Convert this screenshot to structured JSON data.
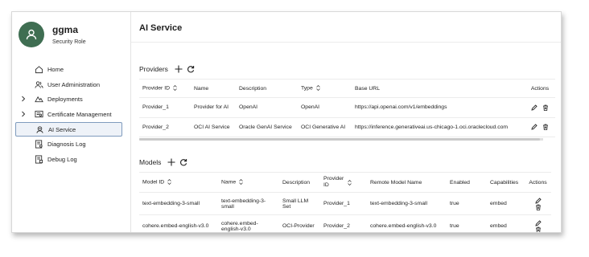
{
  "user": {
    "name": "ggma",
    "role": "Security Role"
  },
  "nav": [
    {
      "label": "Home",
      "icon": "home-icon",
      "chevron": false,
      "active": false
    },
    {
      "label": "User Administration",
      "icon": "users-icon",
      "chevron": false,
      "active": false
    },
    {
      "label": "Deployments",
      "icon": "deployments-icon",
      "chevron": true,
      "active": false
    },
    {
      "label": "Certificate Management",
      "icon": "certificate-icon",
      "chevron": true,
      "active": false
    },
    {
      "label": "AI Service",
      "icon": "ai-service-icon",
      "chevron": false,
      "active": true
    },
    {
      "label": "Diagnosis Log",
      "icon": "diagnosis-log-icon",
      "chevron": false,
      "active": false
    },
    {
      "label": "Debug Log",
      "icon": "debug-log-icon",
      "chevron": false,
      "active": false
    }
  ],
  "page": {
    "title": "AI Service"
  },
  "providers": {
    "label": "Providers",
    "columns": [
      "Provider ID",
      "Name",
      "Description",
      "Type",
      "Base URL",
      "Actions"
    ],
    "rows": [
      [
        "Provider_1",
        "Provider for AI",
        "OpenAI",
        "OpenAI",
        "https://api.openai.com/v1/embeddings"
      ],
      [
        "Provider_2",
        "OCI AI Service",
        "Oracle GenAI Service",
        "OCI Generative AI",
        "https://inference.generativeai.us-chicago-1.oci.oraclecloud.com"
      ]
    ]
  },
  "models": {
    "label": "Models",
    "columns": [
      "Model ID",
      "Name",
      "Description",
      "Provider ID",
      "Remote Model Name",
      "Enabled",
      "Capabilities",
      "Actions"
    ],
    "rows": [
      [
        "text-embedding-3-small",
        "text-embedding-3-small",
        "Small LLM Set",
        "Provider_1",
        "text-embedding-3-small",
        "true",
        "embed"
      ],
      [
        "cohere.embed-english-v3.0",
        "cohere.embed-english-v3.0",
        "OCI-Provider",
        "Provider_2",
        "cohere.embed-english-v3.0",
        "true",
        "embed"
      ]
    ]
  },
  "colors": {
    "avatar": "#3f6e52",
    "active_border": "#7f9bbd",
    "active_bg": "#eef2f8"
  }
}
